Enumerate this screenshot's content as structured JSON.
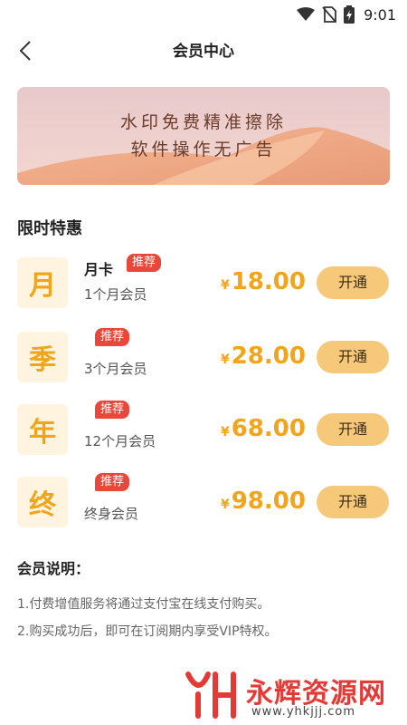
{
  "status_bar": {
    "time": "9:01",
    "icons": [
      "wifi-icon",
      "no-sim-icon",
      "battery-charging-icon"
    ]
  },
  "header": {
    "title": "会员中心",
    "back_icon": "chevron-left-icon"
  },
  "banner": {
    "line1": "水印免费精准擦除",
    "line2": "软件操作无广告"
  },
  "section_title": "限时特惠",
  "plans": [
    {
      "icon_char": "月",
      "name": "月卡",
      "badge": "推荐",
      "desc": "1个月会员",
      "currency": "¥",
      "price": "18.00",
      "button": "开通"
    },
    {
      "icon_char": "季",
      "name": "",
      "badge": "推荐",
      "desc": "3个月会员",
      "currency": "¥",
      "price": "28.00",
      "button": "开通"
    },
    {
      "icon_char": "年",
      "name": "",
      "badge": "推荐",
      "desc": "12个月会员",
      "currency": "¥",
      "price": "68.00",
      "button": "开通"
    },
    {
      "icon_char": "终",
      "name": "",
      "badge": "推荐",
      "desc": "终身会员",
      "currency": "¥",
      "price": "98.00",
      "button": "开通"
    }
  ],
  "notes": {
    "title": "会员说明：",
    "lines": [
      "1.付费增值服务将通过支付宝在线支付购买。",
      "2.购买成功后，即可在订阅期内享受VIP特权。"
    ]
  },
  "watermark": {
    "text": "永辉资源网",
    "url": "www.yhkjjj.com"
  },
  "colors": {
    "accent": "#f2a51a",
    "button_bg": "#f6c879",
    "badge_bg": "#e8473a",
    "icon_bg": "#fff4e0"
  }
}
